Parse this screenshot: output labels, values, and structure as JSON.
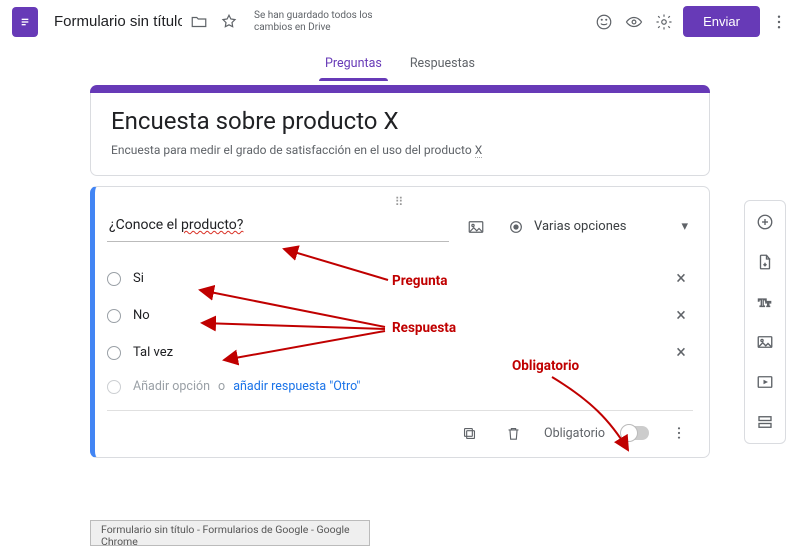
{
  "header": {
    "doc_title": "Formulario sin título",
    "save_msg": "Se han guardado todos los cambios en Drive",
    "send_label": "Enviar"
  },
  "tabs": {
    "questions": "Preguntas",
    "responses": "Respuestas"
  },
  "form": {
    "title": "Encuesta sobre producto X",
    "description_pre": "Encuesta para medir el grado de satisfacción en el uso del producto ",
    "description_dotted": "X"
  },
  "question": {
    "text_pre": "¿Conoce el ",
    "text_squiggle": "producto?",
    "type_label": "Varias opciones",
    "options": [
      "Si",
      "No",
      "Tal vez"
    ],
    "add_option": "Añadir opción",
    "or": "o",
    "add_other": "añadir respuesta \"Otro\"",
    "required_label": "Obligatorio"
  },
  "annotations": {
    "pregunta": "Pregunta",
    "respuesta": "Respuesta",
    "obligatorio": "Obligatorio"
  },
  "taskbar": "Formulario sin título - Formularios de Google - Google Chrome"
}
